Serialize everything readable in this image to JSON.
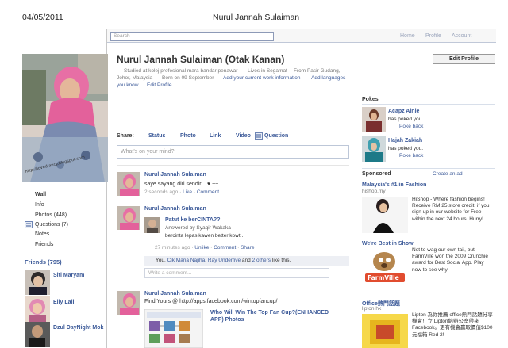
{
  "print_header": {
    "date": "04/05/2011",
    "title": "Nurul Jannah Sulaiman"
  },
  "topbar": {
    "search_placeholder": "Search",
    "nav": [
      "Home",
      "Profile",
      "Account"
    ]
  },
  "profile": {
    "name": "Nurul Jannah Sulaiman (Otak Kanan)",
    "edit_profile_label": "Edit Profile",
    "info": {
      "studied": "Studied at kolej profesional mara bandar penawar",
      "lives": "Lives in Segamat",
      "from": "From Pasir Gudang,",
      "location": "Johor, Malaysia",
      "born": "Born on 09 September",
      "add_work": "Add your current work information",
      "add_languages": "Add languages",
      "you_know": "you know",
      "edit_profile_link": "Edit Profile"
    }
  },
  "left_nav": {
    "items": [
      "Wall",
      "Info",
      "Photos (448)",
      "Questions (7)",
      "Notes",
      "Friends"
    ],
    "friends_header": "Friends (795)",
    "friends": [
      {
        "name": "Siti Maryam"
      },
      {
        "name": "Elly Laili"
      },
      {
        "name": "Dzul DayNight Mok"
      }
    ]
  },
  "share_bar": {
    "label": "Share:",
    "tabs": [
      "Status",
      "Photo",
      "Link",
      "Video",
      "Question"
    ],
    "composer_placeholder": "What's on your mind?"
  },
  "posts": [
    {
      "author": "Nurul Jannah Sulaiman",
      "text": "saye sayang diri sendiri.. ♥ ~~",
      "time": "2 seconds ago",
      "actions": [
        "Like",
        "Comment"
      ]
    },
    {
      "author": "Nurul Jannah Sulaiman",
      "note_title": "Patut ke berCINTA??",
      "answered_by": "Answered by Syaqir Wakaka",
      "answer_text": "bercinta lepas kawen better kowt..",
      "time": "27 minutes ago",
      "actions": [
        "Unlike",
        "Comment",
        "Share"
      ],
      "likes": {
        "prefix": "You,",
        "names": [
          "Cik Maria Najiha",
          "Ray Underfive",
          "2 others"
        ],
        "suffix": "like this."
      },
      "comment_placeholder": "Write a comment..."
    },
    {
      "author": "Nurul Jannah Sulaiman",
      "text": "Find Yours @ http://apps.facebook.com/wintopfancup/",
      "link_title_1": "Who Will Win The Top Fan Cup?(ENHANCED",
      "link_title_2": "APP) Photos"
    }
  ],
  "pokes": {
    "header": "Pokes",
    "items": [
      {
        "name": "Acapz Ainie",
        "text": "has poked you.",
        "action": "Poke back"
      },
      {
        "name": "Hajah Zakiah",
        "text": "has poked you.",
        "action": "Poke back"
      }
    ]
  },
  "ads": {
    "header": "Sponsored",
    "create": "Create an ad",
    "items": [
      {
        "title": "Malaysia's #1 in Fashion",
        "url": "hishop.my",
        "text": "HiShop - Where fashion begins! Receive RM 25 store credit, if you sign up in our website for Free within the next 24 hours. Hurry!"
      },
      {
        "title": "We're Best in Show",
        "url": "",
        "text": "Not to wag our own tail, but FarmVille won the 2009 Crunchie award for Best Social App. Play now to see why!",
        "logo_text": "FarmVille"
      },
      {
        "title": "Office熱門話題",
        "url": "lipton.hk",
        "text": "Lipton 為你推薦 office熱門話題分享機會！立 Lipton給辦公室帶來 Facebook。更有機會贏取價值$100元福箱 Red 2!"
      }
    ]
  }
}
